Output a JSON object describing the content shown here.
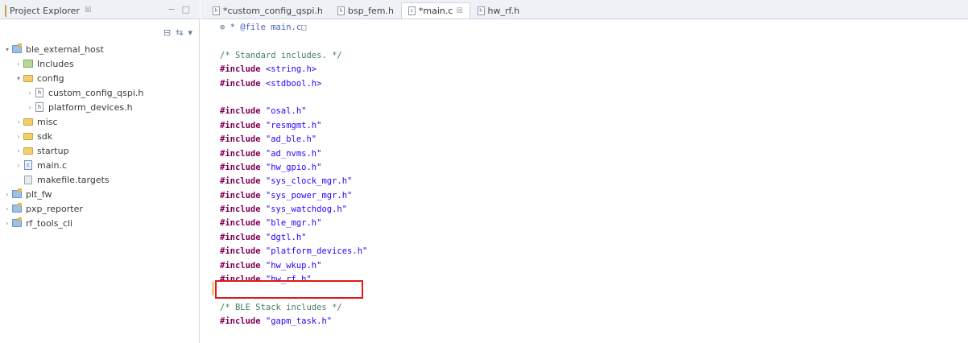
{
  "explorer": {
    "tab_label": "Project Explorer",
    "tab_close": "☒",
    "window_buttons": [
      "−",
      "□"
    ],
    "toolbar_icons": [
      "collapse-all-icon",
      "link-with-editor-icon",
      "view-menu-icon"
    ],
    "tree": [
      {
        "label": "ble_external_host",
        "icon": "project",
        "twisty": "▾",
        "depth": 0
      },
      {
        "label": "Includes",
        "icon": "lib",
        "twisty": "›",
        "depth": 1
      },
      {
        "label": "config",
        "icon": "folder",
        "twisty": "▾",
        "depth": 1
      },
      {
        "label": "custom_config_qspi.h",
        "icon": "hfile",
        "twisty": "›",
        "depth": 2
      },
      {
        "label": "platform_devices.h",
        "icon": "hfile",
        "twisty": "›",
        "depth": 2
      },
      {
        "label": "misc",
        "icon": "folder",
        "twisty": "›",
        "depth": 1
      },
      {
        "label": "sdk",
        "icon": "folder",
        "twisty": "›",
        "depth": 1
      },
      {
        "label": "startup",
        "icon": "folder",
        "twisty": "›",
        "depth": 1
      },
      {
        "label": "main.c",
        "icon": "cfile",
        "twisty": "›",
        "depth": 1
      },
      {
        "label": "makefile.targets",
        "icon": "mk",
        "twisty": "",
        "depth": 1
      },
      {
        "label": "plt_fw",
        "icon": "project",
        "twisty": "›",
        "depth": 0
      },
      {
        "label": "pxp_reporter",
        "icon": "project",
        "twisty": "›",
        "depth": 0
      },
      {
        "label": "rf_tools_cli",
        "icon": "project",
        "twisty": "›",
        "depth": 0
      }
    ]
  },
  "editor": {
    "tabs": [
      {
        "label": "*custom_config_qspi.h",
        "file_icon": "h",
        "active": false,
        "close": ""
      },
      {
        "label": "bsp_fem.h",
        "file_icon": "h",
        "active": false,
        "close": ""
      },
      {
        "label": "*main.c",
        "file_icon": "c",
        "active": true,
        "close": "☒"
      },
      {
        "label": "hw_rf.h",
        "file_icon": "h",
        "active": false,
        "close": ""
      }
    ],
    "code_lines": [
      [
        {
          "t": "fold",
          "v": "⊕ "
        },
        {
          "t": "doc",
          "v": "* @file main.c"
        },
        {
          "t": "fold",
          "v": "□"
        }
      ],
      [],
      [
        {
          "t": "cm",
          "v": "/* Standard includes. */"
        }
      ],
      [
        {
          "t": "kw",
          "v": "#include"
        },
        {
          "t": "txt",
          "v": " "
        },
        {
          "t": "str",
          "v": "<string.h>"
        }
      ],
      [
        {
          "t": "kw",
          "v": "#include"
        },
        {
          "t": "txt",
          "v": " "
        },
        {
          "t": "str",
          "v": "<stdbool.h>"
        }
      ],
      [],
      [
        {
          "t": "kw",
          "v": "#include"
        },
        {
          "t": "txt",
          "v": " "
        },
        {
          "t": "str",
          "v": "\"osal.h\""
        }
      ],
      [
        {
          "t": "kw",
          "v": "#include"
        },
        {
          "t": "txt",
          "v": " "
        },
        {
          "t": "str",
          "v": "\"resmgmt.h\""
        }
      ],
      [
        {
          "t": "kw",
          "v": "#include"
        },
        {
          "t": "txt",
          "v": " "
        },
        {
          "t": "str",
          "v": "\"ad_ble.h\""
        }
      ],
      [
        {
          "t": "kw",
          "v": "#include"
        },
        {
          "t": "txt",
          "v": " "
        },
        {
          "t": "str",
          "v": "\"ad_nvms.h\""
        }
      ],
      [
        {
          "t": "kw",
          "v": "#include"
        },
        {
          "t": "txt",
          "v": " "
        },
        {
          "t": "str",
          "v": "\"hw_gpio.h\""
        }
      ],
      [
        {
          "t": "kw",
          "v": "#include"
        },
        {
          "t": "txt",
          "v": " "
        },
        {
          "t": "str",
          "v": "\"sys_clock_mgr.h\""
        }
      ],
      [
        {
          "t": "kw",
          "v": "#include"
        },
        {
          "t": "txt",
          "v": " "
        },
        {
          "t": "str",
          "v": "\"sys_power_mgr.h\""
        }
      ],
      [
        {
          "t": "kw",
          "v": "#include"
        },
        {
          "t": "txt",
          "v": " "
        },
        {
          "t": "str",
          "v": "\"sys_watchdog.h\""
        }
      ],
      [
        {
          "t": "kw",
          "v": "#include"
        },
        {
          "t": "txt",
          "v": " "
        },
        {
          "t": "str",
          "v": "\"ble_mgr.h\""
        }
      ],
      [
        {
          "t": "kw",
          "v": "#include"
        },
        {
          "t": "txt",
          "v": " "
        },
        {
          "t": "str",
          "v": "\"dgtl.h\""
        }
      ],
      [
        {
          "t": "kw",
          "v": "#include"
        },
        {
          "t": "txt",
          "v": " "
        },
        {
          "t": "str",
          "v": "\"platform_devices.h\""
        }
      ],
      [
        {
          "t": "kw",
          "v": "#include"
        },
        {
          "t": "txt",
          "v": " "
        },
        {
          "t": "str",
          "v": "\"hw_wkup.h\""
        }
      ],
      [
        {
          "t": "kw",
          "v": "#include"
        },
        {
          "t": "txt",
          "v": " "
        },
        {
          "t": "str",
          "v": "\"hw_rf.h\""
        }
      ],
      [],
      [
        {
          "t": "cm",
          "v": "/* BLE Stack includes */"
        }
      ],
      [
        {
          "t": "kw",
          "v": "#include"
        },
        {
          "t": "txt",
          "v": " "
        },
        {
          "t": "str",
          "v": "\"gapm_task.h\""
        }
      ]
    ],
    "highlighted_line": 18,
    "highlight_color": "#e01818"
  }
}
